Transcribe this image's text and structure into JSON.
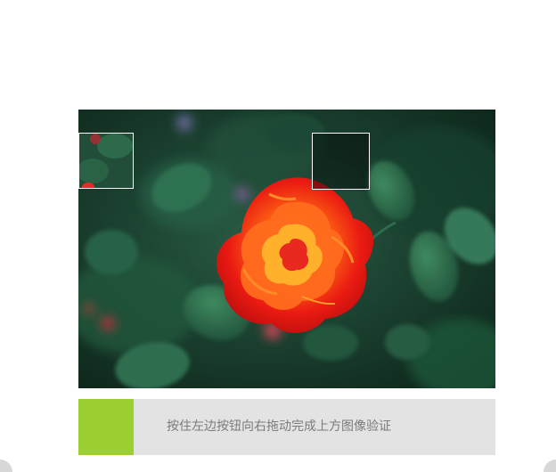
{
  "captcha": {
    "image_description_icon": "rose-photo-icon",
    "slider_hint": "按住左边按钮向右拖动完成上方图像验证",
    "colors": {
      "slider_handle": "#9ccf31",
      "track": "#e3e3e3",
      "hint_text": "#7b7b7b"
    }
  }
}
